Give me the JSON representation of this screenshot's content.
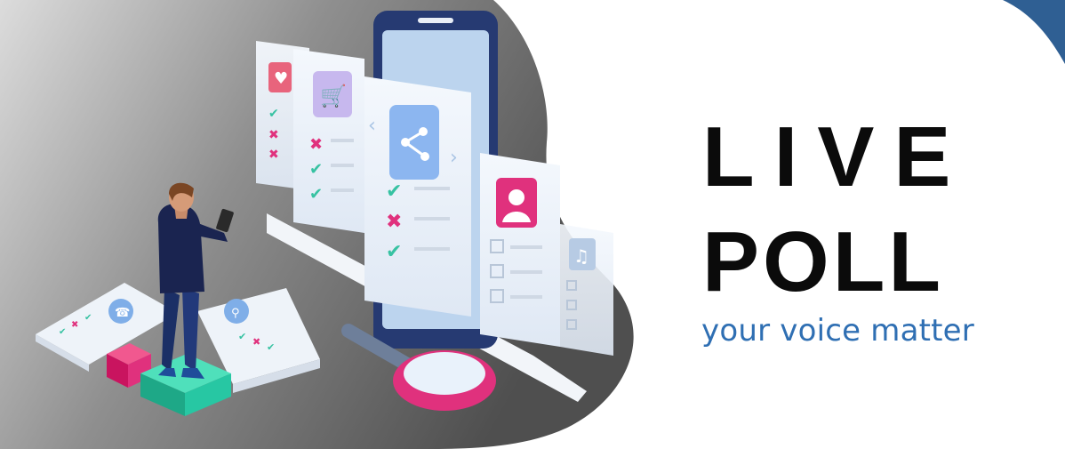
{
  "banner": {
    "title_line_1": "LIVE",
    "title_line_2": "POLL",
    "tagline": "your voice matter"
  },
  "colors": {
    "accent": "#2f6fb3",
    "title": "#0b0b0b",
    "background_gray": "#6f6f6f",
    "check": "#37c2a2",
    "cross": "#e0317d",
    "phone": "#263a72",
    "card": "#eef4fb",
    "pedestal": "#27c7a3"
  },
  "illustration": {
    "icons": [
      "heart-icon",
      "cart-icon",
      "share-icon",
      "user-icon",
      "music-icon",
      "phone-icon",
      "location-icon",
      "magnifier-icon"
    ]
  }
}
